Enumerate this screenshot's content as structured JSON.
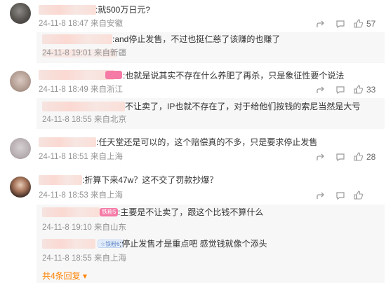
{
  "comments": [
    {
      "text": ":就500万日元?",
      "meta": "24-11-8 18:47 来自安徽",
      "likes": "57",
      "replies": [
        {
          "text": ":and停止发售，不过也挺仁慈了该赚的也赚了",
          "meta": "24-11-8 19:01 来自新疆"
        }
      ]
    },
    {
      "text": ":也就是说其实不存在什么养肥了再杀，只是象征性要个说法",
      "meta": "24-11-8 18:49 来自浙江",
      "likes": "33",
      "replies": [
        {
          "text": "不让卖了，IP也就不存在了，对于给他们按钱的索尼当然是大亏",
          "meta": "24-11-8 18:55 来自北京"
        }
      ]
    },
    {
      "text": ":任天堂还是可以的，这个赔偿真的不多，只是要求停止发售",
      "meta": "24-11-8 18:51 来自上海",
      "likes": "28",
      "replies": []
    },
    {
      "text": ":折算下来47w？这不交了罚款抄爆？",
      "meta": "24-11-8 18:53 来自上海",
      "likes": "",
      "replies": [
        {
          "text": ":主要是不让卖了，跟这个比钱不算什么",
          "meta": "24-11-8 19:10 来自山东",
          "badge": "铁粉5"
        },
        {
          "text": ":停止发售才是重点吧 感觉钱就像个添头",
          "meta": "24-11-8 18:55 来自上海",
          "badge": "☆铁粉6"
        }
      ]
    }
  ],
  "more_replies": "共4条回复 ▾",
  "colors": {
    "accent": "#ff8200",
    "meta": "#939393",
    "reply_bg": "#f7f7f7"
  },
  "icons": [
    "share-icon",
    "comment-icon",
    "like-icon",
    "chevron-down-icon"
  ]
}
